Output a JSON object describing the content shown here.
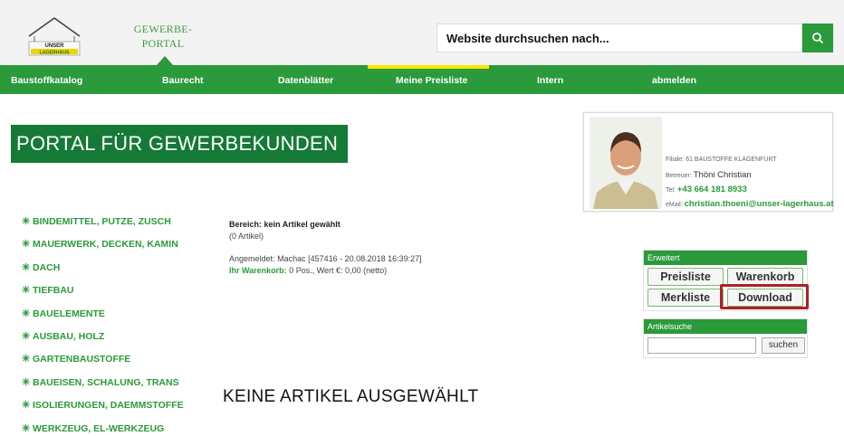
{
  "header": {
    "logo_text_1": "UNSER",
    "logo_text_2": "LAGERHAUS",
    "portal_line1": "GEWERBE-",
    "portal_line2": "PORTAL",
    "search_placeholder": "Website durchsuchen nach...",
    "search_icon": "search-icon"
  },
  "nav": {
    "items": [
      "Baustoffkatalog",
      "Baurecht",
      "Datenblätter",
      "Meine Preisliste",
      "Intern",
      "abmelden"
    ],
    "active": "Meine Preisliste"
  },
  "title": "PORTAL FÜR GEWERBEKUNDEN",
  "contact": {
    "filiale_label": "Filiale:",
    "filiale": "61 BAUSTOFFE KLAGENFURT",
    "betreuer_label": "Betreuer:",
    "betreuer": "Thöni Christian",
    "tel_label": "Tel:",
    "tel": "+43 664 181 8933",
    "email_label": "eMail:",
    "email": "christian.thoeni@unser-lagerhaus.at"
  },
  "categories": [
    "BINDEMITTEL, PUTZE, ZUSCH",
    "MAUERWERK, DECKEN, KAMIN",
    "DACH",
    "TIEFBAU",
    "BAUELEMENTE",
    "AUSBAU, HOLZ",
    "GARTENBAUSTOFFE",
    "BAUEISEN, SCHALUNG, TRANS",
    "ISOLIERUNGEN, DAEMMSTOFFE",
    "WERKZEUG, EL-WERKZEUG"
  ],
  "info": {
    "bereich": "Bereich: kein Artikel gewählt",
    "artikel_count": "(0 Artikel)",
    "angemeldet_label": "Angemeldet:",
    "angemeldet": "Machac [457416 - 20.08.2018 16:39:27]",
    "warenkorb_label": "Ihr Warenkorb:",
    "warenkorb": "0 Pos., Wert €: 0,00 (netto)"
  },
  "no_article": "KEINE ARTIKEL AUSGEWÄHLT",
  "erweitert": {
    "title": "Erweitert",
    "preisliste": "Preisliste",
    "warenkorb": "Warenkorb",
    "merkliste": "Merkliste",
    "download": "Download"
  },
  "artikelsuche": {
    "title": "Artikelsuche",
    "button": "suchen"
  },
  "colors": {
    "brand_green": "#2a9a3a",
    "dark_green": "#157a36",
    "nav_active": "#ffe600",
    "highlight_red": "#b01e2a"
  }
}
